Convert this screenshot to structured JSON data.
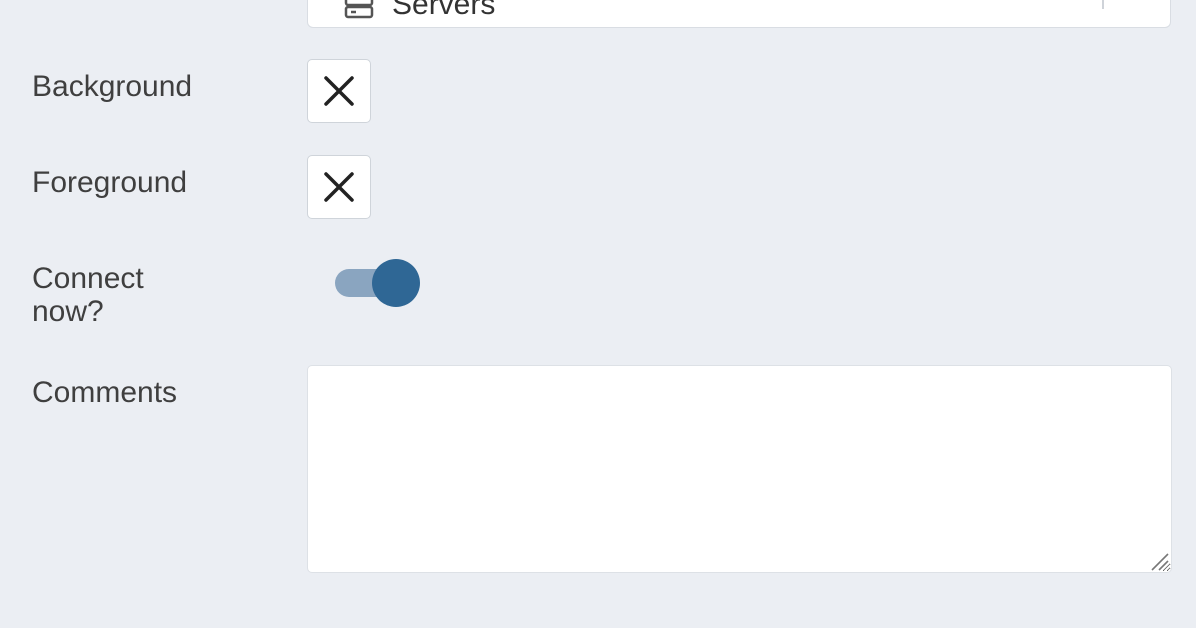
{
  "form": {
    "server_group": {
      "label": "",
      "value": "Servers",
      "icon": "server-icon"
    },
    "background": {
      "label": "Background",
      "value_icon": "close-icon"
    },
    "foreground": {
      "label": "Foreground",
      "value_icon": "close-icon"
    },
    "connect_now": {
      "label_line1": "Connect",
      "label_line2": "now?",
      "checked": true
    },
    "comments": {
      "label": "Comments",
      "value": ""
    }
  },
  "colors": {
    "page_background": "#ebeef3",
    "toggle_track": "#8aa5c0",
    "toggle_knob": "#2f6795",
    "input_background": "#ffffff"
  }
}
